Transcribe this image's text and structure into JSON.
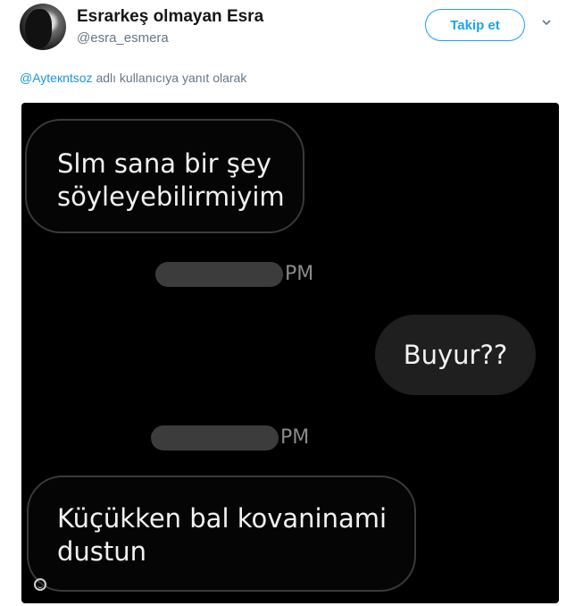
{
  "tweet": {
    "display_name": "Esrarkeş olmayan Esra",
    "handle": "@esra_esmera",
    "follow_label": "Takip et",
    "reply_to": {
      "mention": "@Ayteкntsoz",
      "text": " adlı kullanıcıya yanıt olarak"
    }
  },
  "chat": {
    "messages": [
      {
        "text": "Slm sana bir şey söyleyebilirmiyim",
        "side": "left"
      },
      {
        "text": "Buyur??",
        "side": "right"
      },
      {
        "text": "Küçükken bal kovaninami dustun",
        "side": "left"
      }
    ],
    "timestamps": [
      {
        "suffix": "PM"
      },
      {
        "suffix": "PM"
      }
    ]
  },
  "icons": [
    "avatar",
    "chevron-down-icon",
    "emoji-icon"
  ]
}
